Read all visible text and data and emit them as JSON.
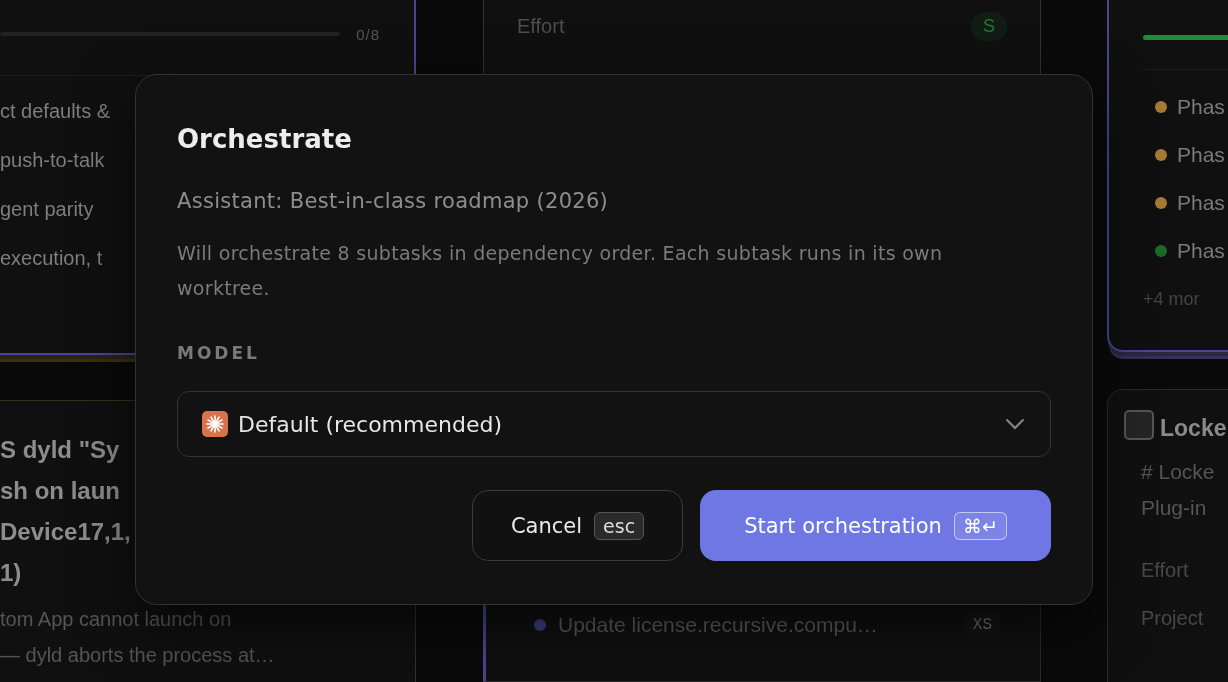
{
  "board": {
    "left_column": {
      "progress_card": {
        "level": 0,
        "count": "0/8",
        "items": [
          "ct defaults &",
          "push-to-talk",
          "gent parity",
          "execution, t"
        ]
      },
      "issue_card": {
        "title_lines": [
          "S dyld \"Sy",
          "sh on laun",
          "Device17,1,",
          "1)"
        ],
        "description_lines": [
          "tom App cannot launch on",
          "— dyld aborts the process at…"
        ]
      }
    },
    "middle_column": {
      "detail_card": {
        "fields": [
          {
            "label": "Effort",
            "value": "S",
            "color": "#1f7a32"
          }
        ]
      },
      "subtask_card": {
        "items": [
          {
            "text": "Update license.recursive.compu…",
            "size": "XS"
          }
        ]
      }
    },
    "right_column": {
      "progress_card": {
        "level": 1,
        "items": [
          {
            "text": "Phas",
            "color": "#a67a33"
          },
          {
            "text": "Phas",
            "color": "#a67a33"
          },
          {
            "text": "Phas",
            "color": "#a67a33"
          },
          {
            "text": "Phas",
            "color": "#1b6a2a"
          }
        ],
        "more": "+4 mor"
      },
      "locked_card": {
        "checked": false,
        "title": "Locke",
        "description_lines": [
          "# Locke",
          "Plug-in"
        ],
        "fields": [
          "Effort",
          "Project"
        ]
      }
    }
  },
  "dialog": {
    "title": "Orchestrate",
    "subtitle": "Assistant: Best-in-class roadmap (2026)",
    "description": "Will orchestrate 8 subtasks in dependency order. Each subtask runs in its own worktree.",
    "model_label": "MODEL",
    "model_select": {
      "value": "Default (recommended)"
    },
    "buttons": [
      {
        "kind": "secondary",
        "label": "Cancel",
        "shortcut": "esc"
      },
      {
        "kind": "primary",
        "label": "Start orchestration",
        "shortcut": "⌘↵"
      }
    ]
  }
}
